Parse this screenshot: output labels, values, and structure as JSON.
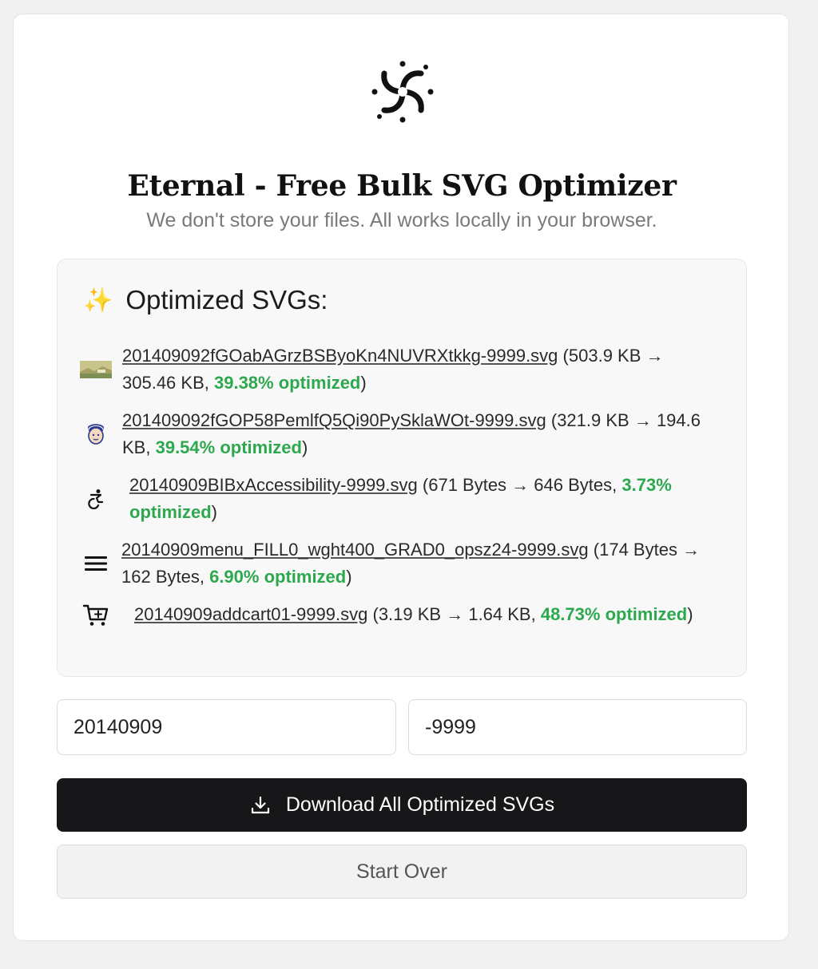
{
  "header": {
    "logo_icon": "swirl-galaxy-icon",
    "title": "Eternal - Free Bulk SVG Optimizer",
    "subtitle": "We don't store your files. All works locally in your browser."
  },
  "results": {
    "heading_icon": "sparkles-icon",
    "heading": "Optimized SVGs:",
    "files": [
      {
        "icon": "landscape-thumbnail-icon",
        "name": "201409092fGOabAGrzBSByoKn4NUVRXtkkg-9999.svg",
        "original_size": "503.9 KB",
        "optimized_size": "305.46 KB",
        "percent": "39.38% optimized"
      },
      {
        "icon": "avatar-face-icon",
        "name": "201409092fGOP58PemlfQ5Qi90PySklaWOt-9999.svg",
        "original_size": "321.9 KB",
        "optimized_size": "194.6 KB",
        "percent": "39.54% optimized"
      },
      {
        "icon": "accessibility-icon",
        "name": "20140909BIBxAccessibility-9999.svg",
        "original_size": "671 Bytes",
        "optimized_size": "646 Bytes",
        "percent": "3.73% optimized"
      },
      {
        "icon": "menu-icon",
        "name": "20140909menu_FILL0_wght400_GRAD0_opsz24-9999.svg",
        "original_size": "174 Bytes",
        "optimized_size": "162 Bytes",
        "percent": "6.90% optimized"
      },
      {
        "icon": "add-cart-icon",
        "name": "20140909addcart01-9999.svg",
        "original_size": "3.19 KB",
        "optimized_size": "1.64 KB",
        "percent": "48.73% optimized"
      }
    ]
  },
  "prefix_input": {
    "value": "20140909"
  },
  "suffix_input": {
    "value": "-9999"
  },
  "download_button": {
    "icon": "download-icon",
    "label": "Download All Optimized SVGs"
  },
  "start_over_button": {
    "label": "Start Over"
  },
  "colors": {
    "optimized_green": "#2ea84f",
    "primary_button": "#17171a"
  }
}
